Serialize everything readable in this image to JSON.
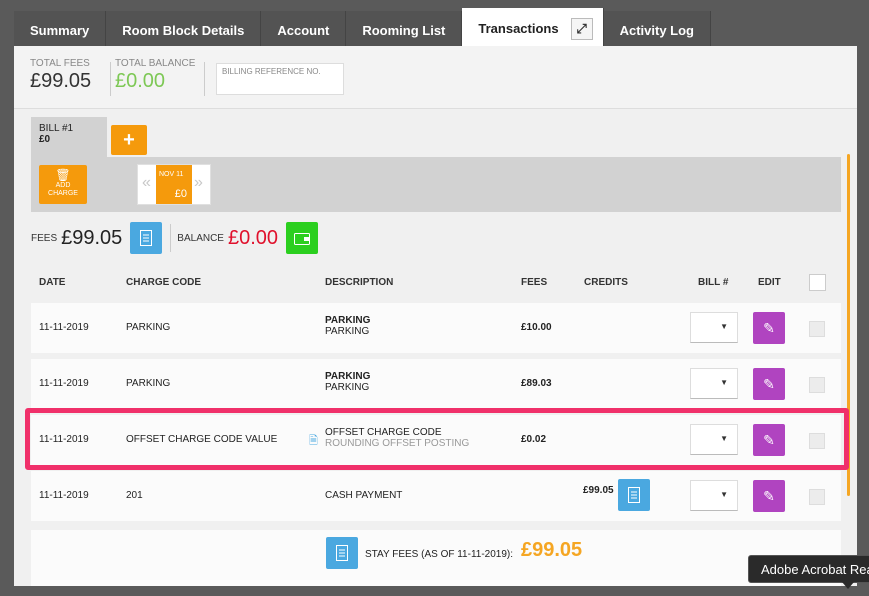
{
  "tabs": [
    {
      "label": "Summary"
    },
    {
      "label": "Room Block Details"
    },
    {
      "label": "Account"
    },
    {
      "label": "Rooming List"
    },
    {
      "label": "Transactions",
      "active": true
    },
    {
      "label": "Activity Log"
    }
  ],
  "summary": {
    "total_fees_label": "TOTAL FEES",
    "total_fees_value": "£99.05",
    "total_balance_label": "TOTAL BALANCE",
    "total_balance_value": "£0.00",
    "billing_ref_placeholder": "BILLING REFERENCE NO."
  },
  "bill": {
    "tab_label": "BILL #1",
    "tab_amount": "£0",
    "add_bill_icon": "+",
    "add_charge_label_1": "ADD",
    "add_charge_label_2": "CHARGE",
    "day_label": "NOV 11",
    "day_amount": "£0"
  },
  "totals_row": {
    "fees_label": "FEES",
    "fees_value": "£99.05",
    "balance_label": "BALANCE",
    "balance_value": "£0.00"
  },
  "table": {
    "headers": {
      "date": "DATE",
      "charge_code": "CHARGE CODE",
      "description": "DESCRIPTION",
      "fees": "FEES",
      "credits": "CREDITS",
      "bill": "BILL #",
      "edit": "EDIT"
    },
    "rows": [
      {
        "date": "11-11-2019",
        "charge_code": "PARKING",
        "desc_main": "PARKING",
        "desc_sub": "PARKING",
        "fees": "£10.00",
        "credits": ""
      },
      {
        "date": "11-11-2019",
        "charge_code": "PARKING",
        "desc_main": "PARKING",
        "desc_sub": "PARKING",
        "fees": "£89.03",
        "credits": ""
      },
      {
        "date": "11-11-2019",
        "charge_code": "OFFSET CHARGE CODE VALUE",
        "desc_main": "OFFSET CHARGE CODE",
        "desc_sub": "ROUNDING OFFSET POSTING",
        "fees": "£0.02",
        "credits": ""
      },
      {
        "date": "11-11-2019",
        "charge_code": "201",
        "desc_main": "CASH PAYMENT",
        "desc_sub": "",
        "fees": "",
        "credits": "£99.05"
      }
    ],
    "footer_label": "STAY FEES (AS OF 11-11-2019):",
    "footer_value": "£99.05"
  },
  "tooltip": "Adobe Acrobat Reader",
  "colors": {
    "accent_orange": "#f59a0c",
    "edit_purple": "#b044c0",
    "invoice_blue": "#4aa8e0",
    "wallet_green": "#2bcf1f",
    "balance_red": "#e0112c",
    "highlight_pink": "#f0306a"
  }
}
